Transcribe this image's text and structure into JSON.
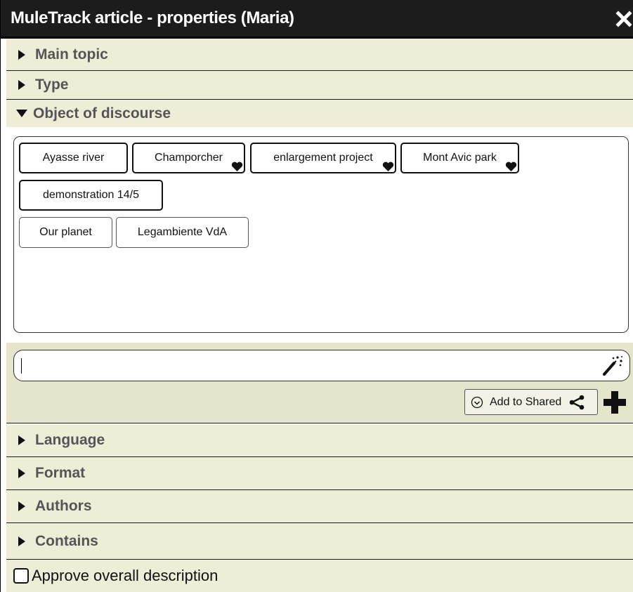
{
  "window": {
    "title": "MuleTrack article - properties (Maria)"
  },
  "sections": {
    "main_topic": "Main topic",
    "type": "Type",
    "object_of_discourse": "Object of discourse",
    "language": "Language",
    "format": "Format",
    "authors": "Authors",
    "contains": "Contains"
  },
  "topics": [
    {
      "label": "Ayasse river",
      "favorite": false,
      "style": "bold"
    },
    {
      "label": "Champorcher",
      "favorite": true,
      "style": "bold"
    },
    {
      "label": "enlargement project",
      "favorite": true,
      "style": "bold"
    },
    {
      "label": "Mont Avic park",
      "favorite": true,
      "style": "bold"
    },
    {
      "label": "demonstration 14/5",
      "favorite": false,
      "style": "bold"
    },
    {
      "label": "Our planet",
      "favorite": false,
      "style": "thin"
    },
    {
      "label": "Legambiente VdA",
      "favorite": false,
      "style": "thin"
    }
  ],
  "entry": {
    "value": "",
    "placeholder": ""
  },
  "actions": {
    "add_to_shared": "Add to Shared"
  },
  "footer": {
    "approve_label": "Approve overall description",
    "approved": false
  },
  "icons": {
    "close": "close-icon",
    "expand": "triangle-right-icon",
    "collapse": "triangle-down-icon",
    "favorite": "heart-icon",
    "suggest": "magic-wand-icon",
    "check": "check-circle-icon",
    "share": "share-icon",
    "add": "plus-icon"
  },
  "colors": {
    "titlebar": "#1c1c1c",
    "section_bg": "#eeeed8",
    "entry_bg": "#e5e5cc",
    "section_text": "#555555"
  }
}
